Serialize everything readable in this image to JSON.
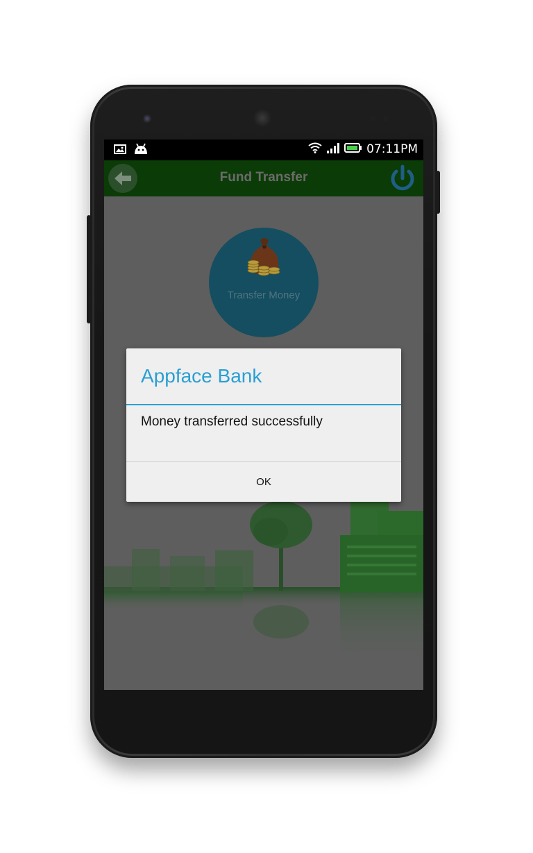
{
  "status_bar": {
    "time": "07:11PM",
    "icons": [
      "image-notification-icon",
      "android-notification-icon",
      "wifi-icon",
      "signal-icon",
      "battery-icon"
    ]
  },
  "app_bar": {
    "title": "Fund Transfer",
    "back_icon": "back-arrow-icon",
    "power_icon": "power-icon"
  },
  "feature": {
    "label": "Transfer Money",
    "icon": "money-bag-icon"
  },
  "dialog": {
    "title": "Appface Bank",
    "message": "Money transferred successfully",
    "ok_label": "OK"
  },
  "colors": {
    "app_bar": "#0b3b06",
    "dialog_accent": "#2a9fd3",
    "feature_circle": "#154e60",
    "scrim_background": "#5e5e5e"
  }
}
